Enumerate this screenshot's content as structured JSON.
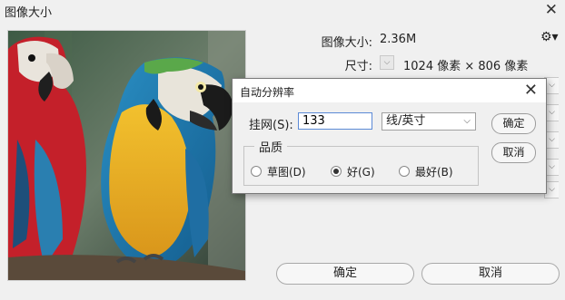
{
  "window": {
    "title": "图像大小"
  },
  "info": {
    "size_label": "图像大小:",
    "size_value": "2.36M",
    "dim_label": "尺寸:",
    "dim_value": "1024 像素 × 806 像素"
  },
  "buttons": {
    "ok": "确定",
    "cancel": "取消"
  },
  "auto_dialog": {
    "title": "自动分辨率",
    "resolution_label": "挂网(S):",
    "resolution_value": "133",
    "unit": "线/英寸",
    "quality_label": "品质",
    "options": [
      {
        "label": "草图(D)",
        "selected": false
      },
      {
        "label": "好(G)",
        "selected": true
      },
      {
        "label": "最好(B)",
        "selected": false
      }
    ],
    "ok": "确定",
    "cancel": "取消"
  },
  "icons": {
    "close": "close-icon",
    "gear": "gear-icon",
    "chevron": "chevron-down-icon"
  }
}
